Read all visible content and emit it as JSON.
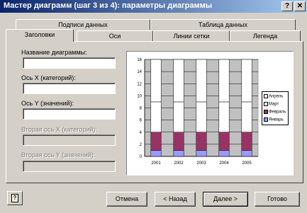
{
  "window": {
    "title": "Мастер диаграмм (шаг 3 из 4): параметры диаграммы",
    "help_button": "?",
    "close_button": "✕"
  },
  "tabs": {
    "row_back": [
      "Подписи данных",
      "Таблица данных"
    ],
    "row_front": [
      "Заголовки",
      "Оси",
      "Линии сетки",
      "Легенда"
    ],
    "active": "Заголовки"
  },
  "fields": [
    {
      "label": "Название диаграммы:",
      "value": "",
      "disabled": false
    },
    {
      "label": "Ось X (категорий):",
      "value": "",
      "disabled": false
    },
    {
      "label": "Ось Y (значений):",
      "value": "",
      "disabled": false
    },
    {
      "label": "Вторая ось X (категорий):",
      "value": "",
      "disabled": true
    },
    {
      "label": "Вторая ось Y (значений):",
      "value": "",
      "disabled": true
    }
  ],
  "chart_data": {
    "type": "bar",
    "stacked": true,
    "categories": [
      "2001",
      "2002",
      "2003",
      "2004",
      "2005"
    ],
    "series": [
      {
        "name": "Январь",
        "values": [
          1,
          1,
          1,
          1,
          1
        ],
        "color": "#9999ff"
      },
      {
        "name": "Февраль",
        "values": [
          3,
          3,
          3,
          3,
          3
        ],
        "color": "#993366"
      },
      {
        "name": "Март",
        "values": [
          5,
          5,
          5,
          5,
          5
        ],
        "color": "#ffffff"
      },
      {
        "name": "Апрель",
        "values": [
          7,
          7,
          7,
          7,
          7
        ],
        "color": "#ffffff"
      }
    ],
    "ylim": [
      0,
      16
    ],
    "yticks": [
      "0",
      "2",
      "4",
      "6",
      "8",
      "10",
      "12",
      "14",
      "16"
    ],
    "legend_position": "right",
    "grid": true
  },
  "buttons": {
    "cancel": "Отмена",
    "back": "< Назад",
    "next": "Далее >",
    "finish": "Готово"
  }
}
